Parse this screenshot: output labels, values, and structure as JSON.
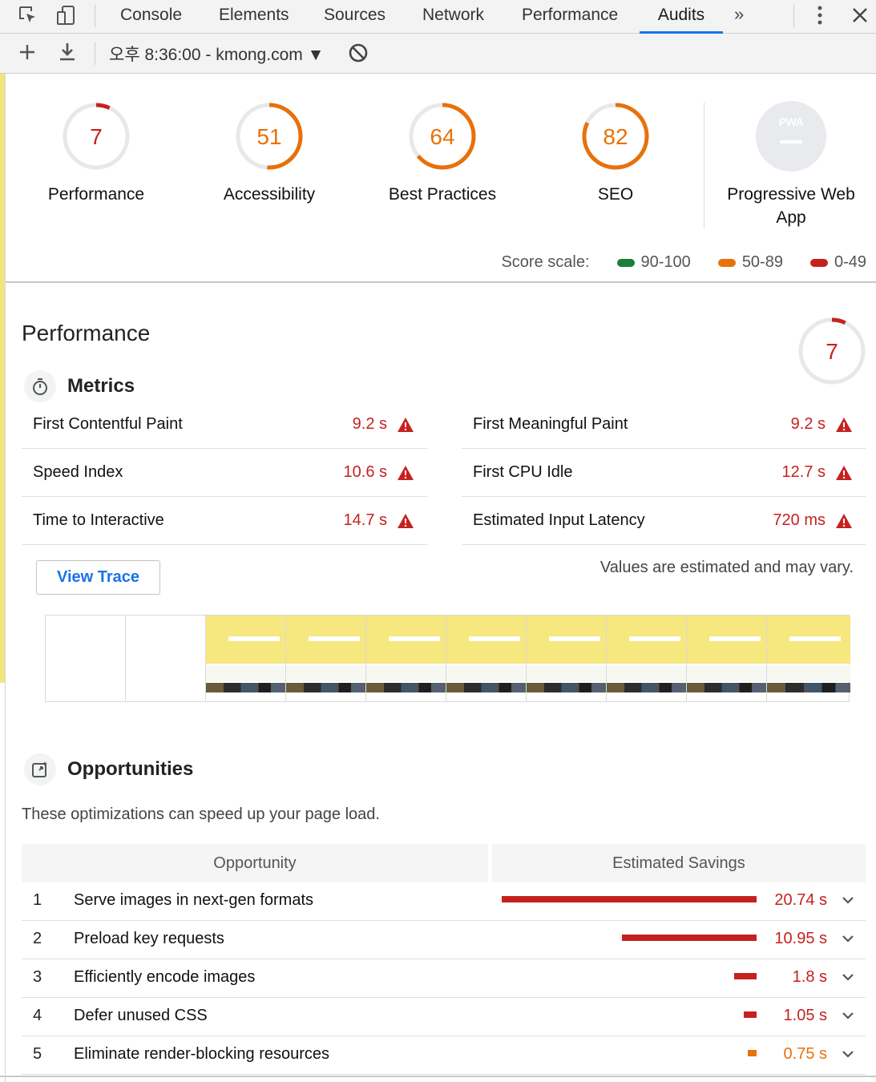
{
  "tabs": [
    {
      "label": "Console"
    },
    {
      "label": "Elements"
    },
    {
      "label": "Sources"
    },
    {
      "label": "Network"
    },
    {
      "label": "Performance"
    },
    {
      "label": "Audits"
    }
  ],
  "active_tab": "Audits",
  "toolbar": {
    "report_label": "오후 8:36:00 - kmong.com ▼"
  },
  "colors": {
    "fail": "#c5221f",
    "average": "#e8710a",
    "pass": "#188038",
    "accent": "#1a73e8"
  },
  "categories": [
    {
      "label": "Performance",
      "score": "7",
      "level": "fail"
    },
    {
      "label": "Accessibility",
      "score": "51",
      "level": "average"
    },
    {
      "label": "Best Practices",
      "score": "64",
      "level": "average"
    },
    {
      "label": "SEO",
      "score": "82",
      "level": "average"
    }
  ],
  "pwa": {
    "badge": "PWA",
    "label": "Progressive Web App"
  },
  "score_scale": {
    "label": "Score scale:",
    "pass": "90-100",
    "average": "50-89",
    "fail": "0-49"
  },
  "performance": {
    "title": "Performance",
    "score": "7",
    "metrics_title": "Metrics",
    "metrics": [
      {
        "label": "First Contentful Paint",
        "value": "9.2 s"
      },
      {
        "label": "First Meaningful Paint",
        "value": "9.2 s"
      },
      {
        "label": "Speed Index",
        "value": "10.6 s"
      },
      {
        "label": "First CPU Idle",
        "value": "12.7 s"
      },
      {
        "label": "Time to Interactive",
        "value": "14.7 s"
      },
      {
        "label": "Estimated Input Latency",
        "value": "720 ms"
      }
    ],
    "view_trace": "View Trace",
    "estimate_note": "Values are estimated and may vary."
  },
  "opportunities": {
    "title": "Opportunities",
    "description": "These optimizations can speed up your page load.",
    "col_opportunity": "Opportunity",
    "col_savings": "Estimated Savings",
    "rows": [
      {
        "index": "1",
        "label": "Serve images in next-gen formats",
        "savings": "20.74 s",
        "seconds": 20.74,
        "level": "fail"
      },
      {
        "index": "2",
        "label": "Preload key requests",
        "savings": "10.95 s",
        "seconds": 10.95,
        "level": "fail"
      },
      {
        "index": "3",
        "label": "Efficiently encode images",
        "savings": "1.8 s",
        "seconds": 1.8,
        "level": "fail"
      },
      {
        "index": "4",
        "label": "Defer unused CSS",
        "savings": "1.05 s",
        "seconds": 1.05,
        "level": "fail"
      },
      {
        "index": "5",
        "label": "Eliminate render-blocking resources",
        "savings": "0.75 s",
        "seconds": 0.75,
        "level": "average"
      }
    ]
  }
}
